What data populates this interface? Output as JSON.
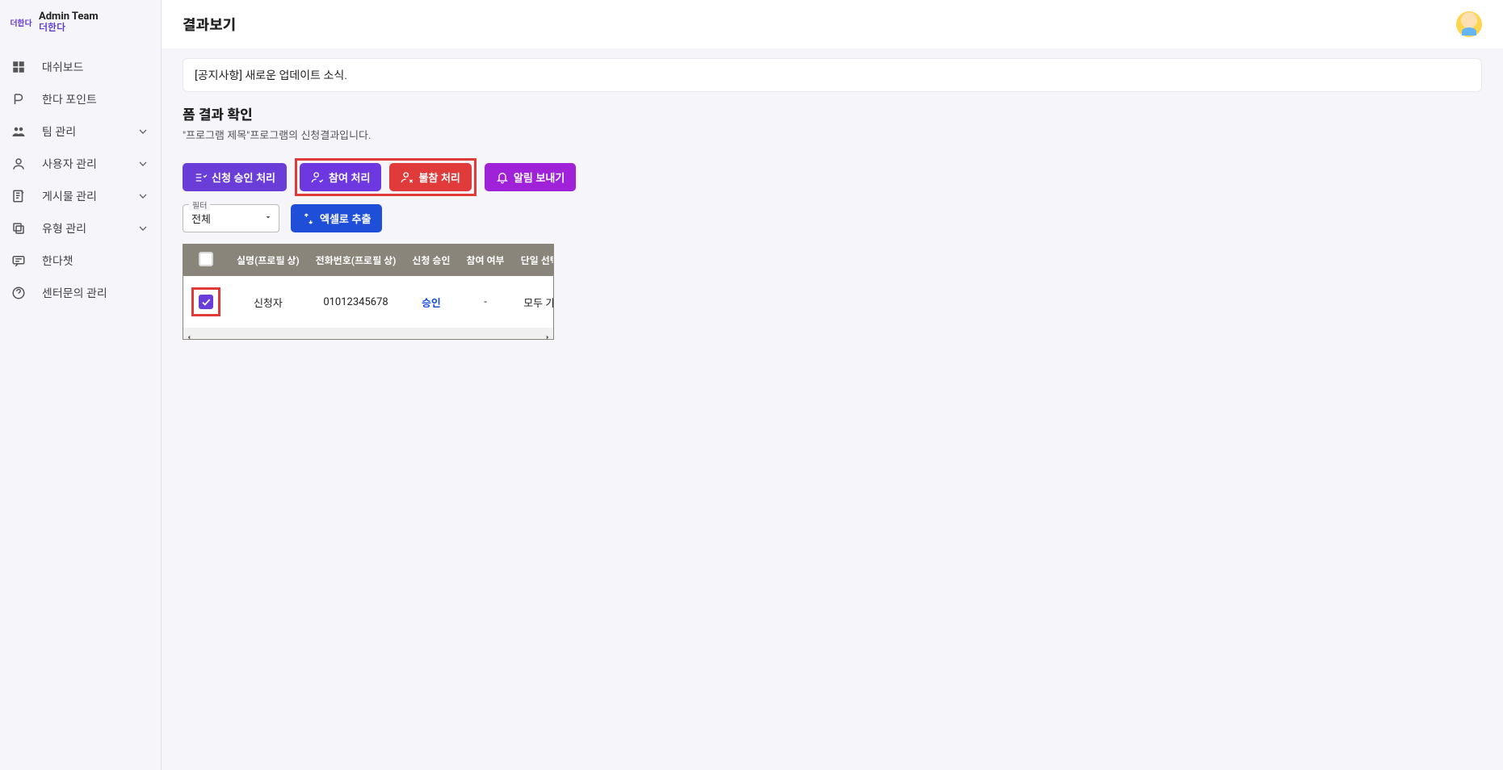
{
  "header": {
    "team_name": "Admin Team",
    "team_sub": "더한다",
    "logo_text": "더한다"
  },
  "topbar": {
    "title": "결과보기"
  },
  "sidebar": {
    "items": [
      {
        "label": "대쉬보드",
        "expandable": false
      },
      {
        "label": "한다 포인트",
        "expandable": false
      },
      {
        "label": "팀 관리",
        "expandable": true
      },
      {
        "label": "사용자 관리",
        "expandable": true
      },
      {
        "label": "게시물 관리",
        "expandable": true
      },
      {
        "label": "유형 관리",
        "expandable": true
      },
      {
        "label": "한다챗",
        "expandable": false
      },
      {
        "label": "센터문의 관리",
        "expandable": false
      }
    ]
  },
  "notice": {
    "text": "[공지사항] 새로운 업데이트 소식."
  },
  "section": {
    "title": "폼 결과 확인",
    "subtitle": "\"프로그램 제목\"프로그램의 신청결과입니다."
  },
  "buttons": {
    "approve": "신청 승인 처리",
    "attend": "참여 처리",
    "absent": "불참 처리",
    "notify": "알림 보내기",
    "export": "엑셀로 추출"
  },
  "filter": {
    "label": "필터",
    "value": "전체"
  },
  "table": {
    "headers": [
      "",
      "실명(프로필 상)",
      "전화번호(프로필 상)",
      "신청 승인",
      "참여 여부",
      "단일 선택형"
    ],
    "rows": [
      {
        "checked": true,
        "name": "신청자",
        "phone": "01012345678",
        "approval": "승인",
        "attendance": "-",
        "single_choice": "모두 가능"
      }
    ]
  }
}
